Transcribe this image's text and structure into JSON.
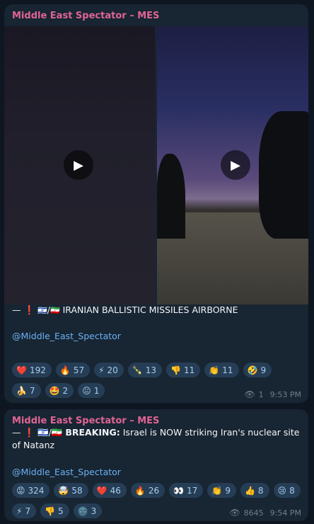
{
  "messages": [
    {
      "sender": "Middle East Spectator – MES",
      "text_parts": [
        "— ❗ ",
        "🇮🇱",
        "/",
        "🇮🇷",
        " IRANIAN BALLISTIC MISSILES AIRBORNE"
      ],
      "link": "@Middle_East_Spectator",
      "reactions": [
        {
          "emoji": "❤️",
          "count": "192"
        },
        {
          "emoji": "🔥",
          "count": "57"
        },
        {
          "emoji": "⚡",
          "count": "20"
        },
        {
          "emoji": "🍾",
          "count": "13"
        },
        {
          "emoji": "👎",
          "count": "11"
        },
        {
          "emoji": "👏",
          "count": "11"
        },
        {
          "emoji": "🤣",
          "count": "9"
        },
        {
          "emoji": "🍌",
          "count": "7"
        },
        {
          "emoji": "🤩",
          "count": "2"
        },
        {
          "emoji": "😐",
          "count": "1"
        }
      ],
      "views": "1",
      "time": "9:53 PM"
    },
    {
      "sender": "Middle East Spectator – MES",
      "text_bold": "BREAKING:",
      "text_rest": " Israel is NOW striking Iran's nuclear site of Natanz",
      "text_prefix": "— ❗ 🇮🇱/🇮🇷 ",
      "link": "@Middle_East_Spectator",
      "reactions": [
        {
          "emoji": "😡",
          "count": "324"
        },
        {
          "emoji": "🤯",
          "count": "58"
        },
        {
          "emoji": "❤️",
          "count": "46"
        },
        {
          "emoji": "🔥",
          "count": "26"
        },
        {
          "emoji": "👀",
          "count": "17"
        },
        {
          "emoji": "👏",
          "count": "9"
        },
        {
          "emoji": "👍",
          "count": "8"
        },
        {
          "emoji": "😢",
          "count": "8"
        },
        {
          "emoji": "⚡",
          "count": "7"
        },
        {
          "emoji": "👎",
          "count": "5"
        },
        {
          "emoji": "🌚",
          "count": "3"
        }
      ],
      "views": "8645",
      "time": "9:54 PM"
    }
  ]
}
